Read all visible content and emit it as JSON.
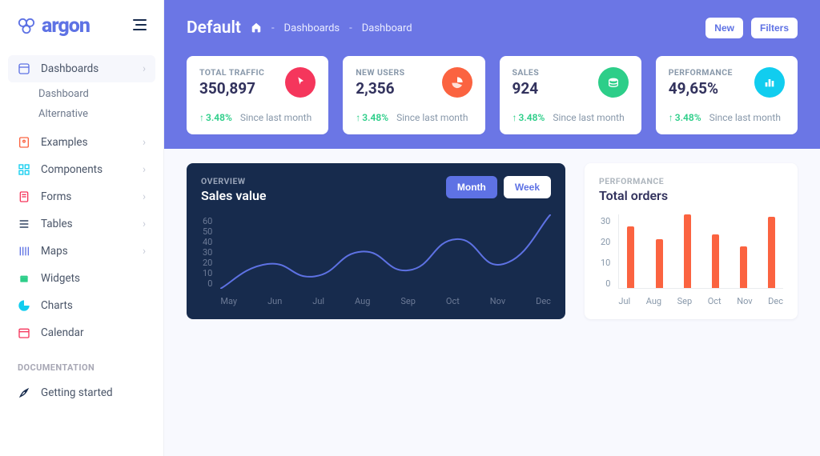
{
  "brand": {
    "name": "argon"
  },
  "nav": {
    "items": [
      {
        "label": "Dashboards",
        "icon_color": "#5e72e4"
      },
      {
        "label": "Examples",
        "icon_color": "#fb6340"
      },
      {
        "label": "Components",
        "icon_color": "#11cdef"
      },
      {
        "label": "Forms",
        "icon_color": "#f5365c"
      },
      {
        "label": "Tables",
        "icon_color": "#172b4d"
      },
      {
        "label": "Maps",
        "icon_color": "#5e72e4"
      },
      {
        "label": "Widgets",
        "icon_color": "#2dce89"
      },
      {
        "label": "Charts",
        "icon_color": "#11cdef"
      },
      {
        "label": "Calendar",
        "icon_color": "#f5365c"
      }
    ],
    "dashboards_sub": [
      "Dashboard",
      "Alternative"
    ],
    "documentation_label": "DOCUMENTATION",
    "doc_items": [
      {
        "label": "Getting started"
      }
    ]
  },
  "header": {
    "title": "Default",
    "crumbs": [
      "Dashboards",
      "Dashboard"
    ],
    "actions": {
      "new": "New",
      "filters": "Filters"
    }
  },
  "stats": [
    {
      "label": "TOTAL TRAFFIC",
      "value": "350,897",
      "delta": "3.48%",
      "period": "Since last month",
      "icon_bg": "#f5365c",
      "icon": "pointer"
    },
    {
      "label": "NEW USERS",
      "value": "2,356",
      "delta": "3.48%",
      "period": "Since last month",
      "icon_bg": "#fb6340",
      "icon": "pie-chart"
    },
    {
      "label": "SALES",
      "value": "924",
      "delta": "3.48%",
      "period": "Since last month",
      "icon_bg": "#2dce89",
      "icon": "coins"
    },
    {
      "label": "PERFORMANCE",
      "value": "49,65%",
      "delta": "3.48%",
      "period": "Since last month",
      "icon_bg": "#11cdef",
      "icon": "bar-chart"
    }
  ],
  "panels": {
    "sales": {
      "overline": "OVERVIEW",
      "title": "Sales value",
      "toggle": {
        "month": "Month",
        "week": "Week",
        "active": "month"
      }
    },
    "orders": {
      "overline": "PERFORMANCE",
      "title": "Total orders"
    }
  },
  "chart_data": [
    {
      "id": "sales",
      "type": "line",
      "categories": [
        "May",
        "Jun",
        "Jul",
        "Aug",
        "Sep",
        "Oct",
        "Nov",
        "Dec"
      ],
      "values": [
        0,
        20,
        10,
        30,
        15,
        40,
        20,
        60
      ],
      "title": "Sales value",
      "y_ticks": [
        0,
        10,
        20,
        30,
        40,
        50,
        60
      ],
      "ylim": [
        0,
        60
      ],
      "line_color": "#5e72e4"
    },
    {
      "id": "orders",
      "type": "bar",
      "categories": [
        "Jul",
        "Aug",
        "Sep",
        "Oct",
        "Nov",
        "Dec"
      ],
      "values": [
        25,
        20,
        30,
        22,
        17,
        29
      ],
      "title": "Total orders",
      "y_ticks": [
        0,
        10,
        20,
        30
      ],
      "ylim": [
        0,
        30
      ],
      "bar_color": "#fb6340"
    }
  ]
}
